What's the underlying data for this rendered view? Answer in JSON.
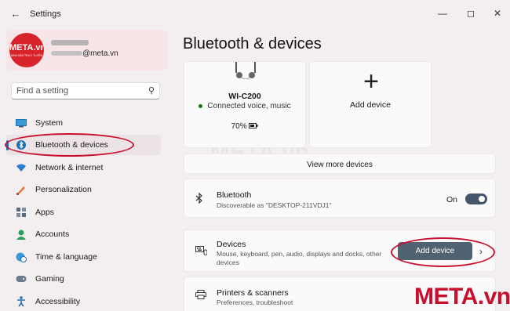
{
  "window": {
    "title": "Settings"
  },
  "profile": {
    "email": "@meta.vn",
    "avatar_text": "META.vn",
    "avatar_subtext": "MUA SẮM TRỰC TUYẾN"
  },
  "search": {
    "placeholder": "Find a setting"
  },
  "nav": [
    {
      "label": "System",
      "icon": "monitor-icon"
    },
    {
      "label": "Bluetooth & devices",
      "icon": "bluetooth-icon",
      "active": true
    },
    {
      "label": "Network & internet",
      "icon": "wifi-icon"
    },
    {
      "label": "Personalization",
      "icon": "brush-icon"
    },
    {
      "label": "Apps",
      "icon": "apps-icon"
    },
    {
      "label": "Accounts",
      "icon": "person-icon"
    },
    {
      "label": "Time & language",
      "icon": "globe-clock-icon"
    },
    {
      "label": "Gaming",
      "icon": "gamepad-icon"
    },
    {
      "label": "Accessibility",
      "icon": "accessibility-icon"
    }
  ],
  "main": {
    "title": "Bluetooth & devices",
    "device": {
      "name": "WI-C200",
      "status": "Connected voice, music",
      "battery": "70%"
    },
    "add_device_tile": "Add device",
    "view_more": "View more devices",
    "bluetooth_row": {
      "title": "Bluetooth",
      "subtitle": "Discoverable as \"DESKTOP-211VDJ1\"",
      "state": "On"
    },
    "devices_row": {
      "title": "Devices",
      "subtitle1": "Mouse, keyboard, pen, audio, displays and docks, other",
      "subtitle2": "devices",
      "button": "Add device"
    },
    "printers_row": {
      "title": "Printers & scanners",
      "subtitle": "Preferences, troubleshoot"
    }
  },
  "watermark": {
    "brand": "META.vn",
    "ghost": "META.vn"
  },
  "colors": {
    "accent": "#1f6fb6",
    "annotation": "#c8102e",
    "toggle": "#43566a",
    "button": "#4f6373"
  }
}
